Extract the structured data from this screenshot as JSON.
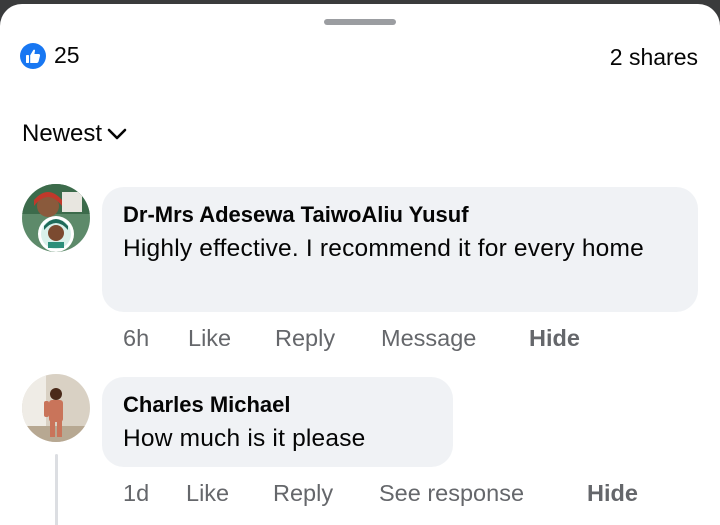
{
  "header": {
    "reaction_count": "25",
    "shares": "2 shares",
    "reaction_icon": "like-icon",
    "accent": "#1877f2"
  },
  "sort": {
    "label": "Newest",
    "icon": "chevron-down-icon"
  },
  "comments": [
    {
      "author": "Dr-Mrs Adesewa TaiwoAliu Yusuf",
      "text": "Highly effective. I recommend it for every home",
      "time": "6h",
      "actions": [
        "Like",
        "Reply",
        "Message",
        "Hide"
      ]
    },
    {
      "author": "Charles Michael",
      "text": "How much is it please",
      "time": "1d",
      "actions": [
        "Like",
        "Reply",
        "See response",
        "Hide"
      ]
    }
  ]
}
